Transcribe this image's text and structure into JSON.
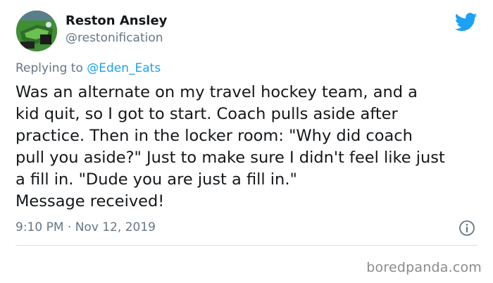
{
  "author": {
    "name": "Reston Ansley",
    "handle": "@restonification",
    "avatar_icon": "profile-photo"
  },
  "brand": {
    "icon": "twitter-bird-icon",
    "color": "#1da1f2"
  },
  "reply": {
    "prefix": "Replying to ",
    "mention": "@Eden_Eats"
  },
  "tweet": {
    "lines": [
      "Was an alternate on my travel hockey team, and a",
      "kid quit, so I got to start. Coach pulls aside after",
      "practice. Then in the locker room: \"Why did coach",
      "pull you aside?\" Just to make sure I didn't feel like just",
      "a fill in. \"Dude you are just a fill in.\"",
      "Message received!"
    ]
  },
  "meta": {
    "timestamp": "9:10 PM · Nov 12, 2019",
    "info_icon": "info-icon"
  },
  "watermark": {
    "text": "boredpanda.com"
  }
}
